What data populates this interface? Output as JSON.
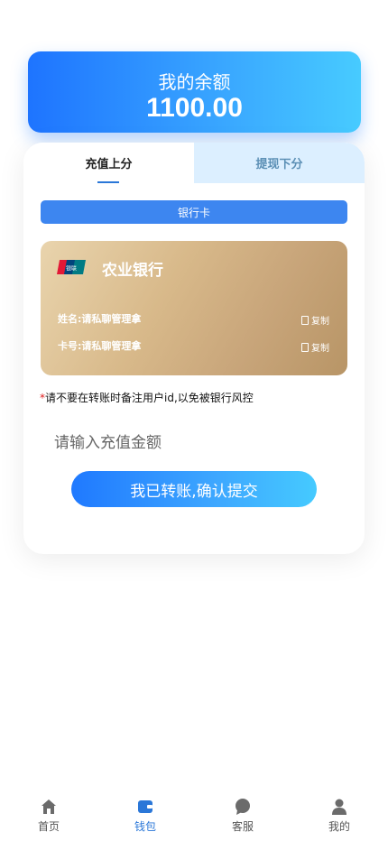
{
  "balance": {
    "label": "我的余额",
    "value": "1100.00"
  },
  "tabs": {
    "deposit": "充值上分",
    "withdraw": "提现下分"
  },
  "bank_card_bar": "银行卡",
  "bank_card": {
    "logo_text": "银联",
    "bank_name": "农业银行",
    "holder_label": "姓名:",
    "holder_value": "请私聊管理拿",
    "card_label": "卡号:",
    "card_value": "请私聊管理拿",
    "copy_label": "复制"
  },
  "notice": {
    "star": "*",
    "text": "请不要在转账时备注用户id,以免被银行风控"
  },
  "amount_input": {
    "placeholder": "请输入充值金额",
    "value": ""
  },
  "submit_label": "我已转账,确认提交",
  "tabbar": {
    "items": [
      {
        "label": "首页",
        "icon": "home-icon"
      },
      {
        "label": "钱包",
        "icon": "wallet-icon",
        "active": true
      },
      {
        "label": "客服",
        "icon": "chat-icon"
      },
      {
        "label": "我的",
        "icon": "user-icon"
      }
    ]
  },
  "colors": {
    "accent": "#2a77d8",
    "gradient_start": "#1e74ff",
    "gradient_end": "#47cbff",
    "card_gold": "#c8a57a"
  }
}
